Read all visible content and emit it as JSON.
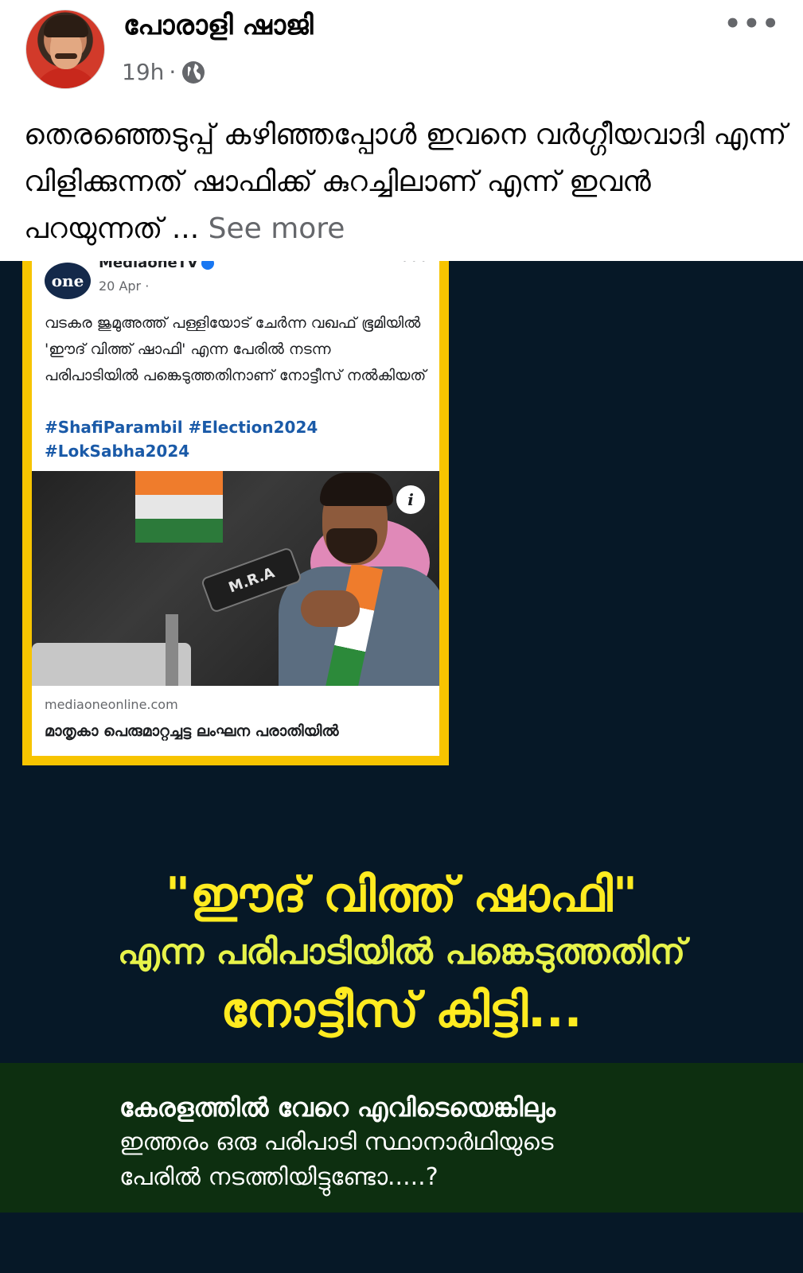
{
  "post": {
    "author": "പോരാളി ഷാജി",
    "time": "19h",
    "separator": "·",
    "privacy_icon": "globe-icon",
    "more_icon": "•••",
    "text": "തെരഞ്ഞെടുപ്പ് കഴിഞ്ഞപ്പോൾ ഇവനെ വർഗ്ഗീയവാദി എന്ന് വിളിക്കുന്നത് ഷാഫിക്ക് കുറച്ചിലാണ് എന്ന് ഇവൻ പറയുന്നത് ... ",
    "see_more": "See more"
  },
  "embedded_card": {
    "logo_text": "one",
    "page_name": "MediaoneTV",
    "date": "20 Apr ·",
    "text": "വടകര ജുമുഅത്ത് പള്ളിയോട് ചേർന്ന വഖഫ് ഭൂമിയിൽ 'ഈദ് വിത്ത് ഷാഫി' എന്ന പേരിൽ നടന്ന പരിപാടിയിൽ പങ്കെടുത്തതിനാണ് നോട്ടീസ് നൽകിയത്",
    "hashtags": "#ShafiParambil #Election2024 #LokSabha2024",
    "mic_label": "M.R.A",
    "info_icon": "i",
    "link_domain": "mediaoneonline.com",
    "link_title": "മാതൃകാ പെരുമാറ്റച്ചട്ട ലംഘന പരാതിയിൽ"
  },
  "poster": {
    "line1": "\"ഈദ് വിത്ത് ഷാഫി\"",
    "line2": "എന്ന പരിപാടിയിൽ പങ്കെടുത്തതിന്",
    "line3": "നോട്ടീസ് കിട്ടി...",
    "box_line1": "കേരളത്തിൽ വേറെ എവിടെയെങ്കിലും",
    "box_line2": "ഇത്തരം ഒരു പരിപാടി സ്ഥാനാർഥിയുടെ",
    "box_line3": "പേരിൽ നടത്തിയിട്ടുണ്ടോ.....?"
  },
  "colors": {
    "poster_bg": "#061827",
    "card_border": "#f7c400",
    "headline_yellow": "#ffeb20",
    "box_green": "#0d2f10",
    "hashtag_blue": "#1a5aa8"
  }
}
